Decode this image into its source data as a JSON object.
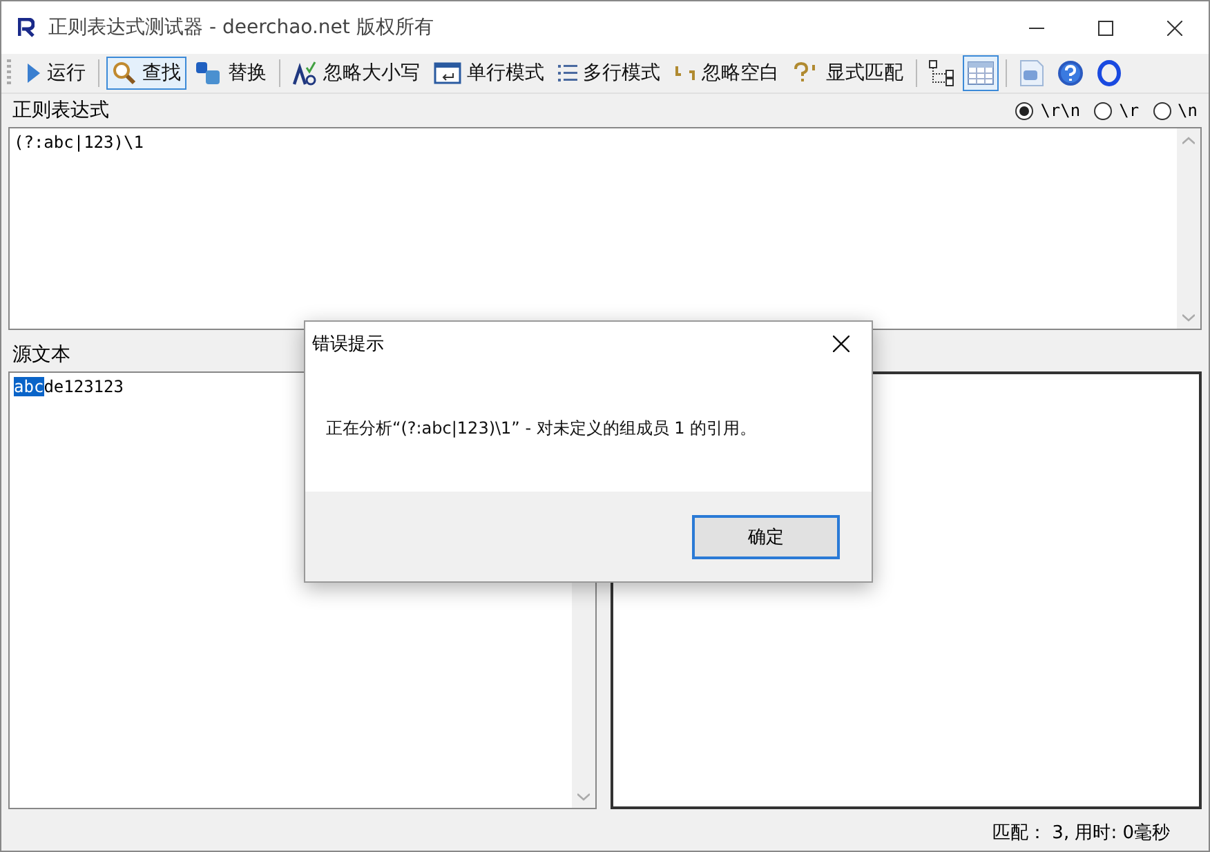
{
  "window": {
    "title": "正则表达式测试器 - deerchao.net 版权所有"
  },
  "toolbar": [
    {
      "label": "运行",
      "selected": false
    },
    {
      "label": "查找",
      "selected": true
    },
    {
      "label": "替换",
      "selected": false
    },
    {
      "label": "忽略大小写",
      "selected": false
    },
    {
      "label": "单行模式",
      "selected": false
    },
    {
      "label": "多行模式",
      "selected": false
    },
    {
      "label": "忽略空白",
      "selected": false
    },
    {
      "label": "显式匹配",
      "selected": false
    }
  ],
  "toolbar_icons": [
    {
      "selected": false
    },
    {
      "selected": true
    },
    {
      "selected": false
    },
    {
      "selected": false
    },
    {
      "selected": false
    }
  ],
  "regex": {
    "label": "正则表达式",
    "value": "(?:abc|123)\\1"
  },
  "line_endings": [
    {
      "label": "\\r\\n",
      "selected": true
    },
    {
      "label": "\\r",
      "selected": false
    },
    {
      "label": "\\n",
      "selected": false
    }
  ],
  "source": {
    "label": "源文本",
    "highlighted": "abc",
    "rest": "de123123"
  },
  "dialog": {
    "title": "错误提示",
    "message": "正在分析“(?:abc|123)\\1” - 对未定义的组成员 1 的引用。",
    "button": "确定"
  },
  "status_bar": {
    "text": "匹配： 3, 用时: 0毫秒"
  }
}
